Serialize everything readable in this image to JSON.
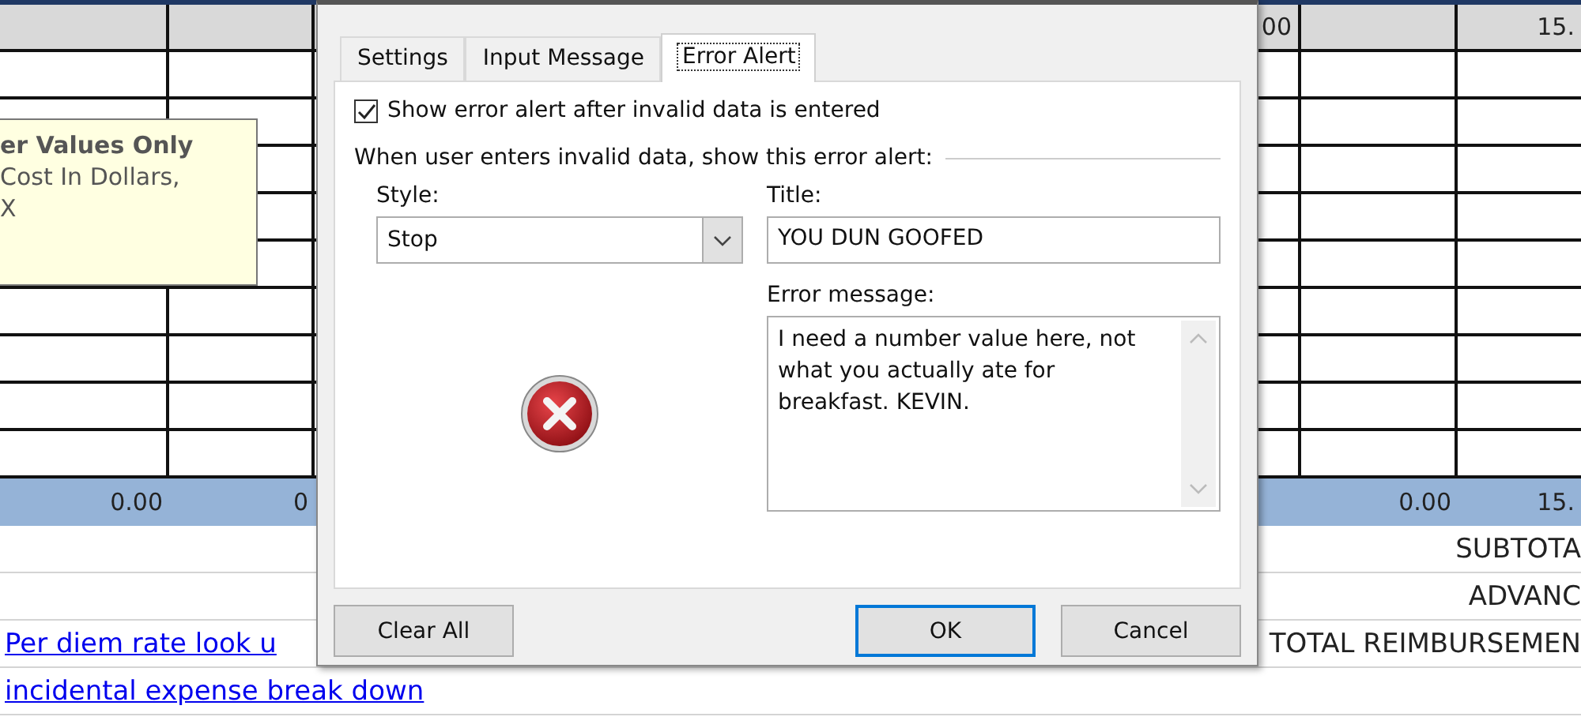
{
  "sheet": {
    "header_row": {
      "column_4": "00",
      "column_6": "15."
    },
    "total_row": {
      "column_1": "0.00",
      "column_2": "0",
      "column_5": "0.00",
      "column_6": "15."
    },
    "summary_rows": [
      {
        "label": "SUBTOTA"
      },
      {
        "label": "ADVANC"
      },
      {
        "link": "Per diem rate look u",
        "label": "TOTAL REIMBURSEMEN"
      },
      {
        "link": "incidental expense break down"
      }
    ]
  },
  "tooltip": {
    "title": "er Values Only",
    "lines": [
      "Cost In Dollars,",
      "X"
    ]
  },
  "dialog": {
    "tabs": [
      {
        "label": "Settings",
        "selected": false
      },
      {
        "label": "Input Message",
        "selected": false
      },
      {
        "label": "Error Alert",
        "selected": true
      }
    ],
    "show_alert": {
      "label": "Show error alert after invalid data is entered",
      "checked": true
    },
    "section_heading": "When user enters invalid data, show this error alert:",
    "style": {
      "label": "Style:",
      "value": "Stop"
    },
    "title": {
      "label": "Title:",
      "value": "YOU DUN GOOFED"
    },
    "message": {
      "label": "Error message:",
      "value": "I need a number value here, not what you actually ate for breakfast. KEVIN."
    },
    "buttons": [
      {
        "label": "Clear All",
        "default": false
      },
      {
        "label": "OK",
        "default": true
      },
      {
        "label": "Cancel",
        "default": false
      }
    ]
  }
}
